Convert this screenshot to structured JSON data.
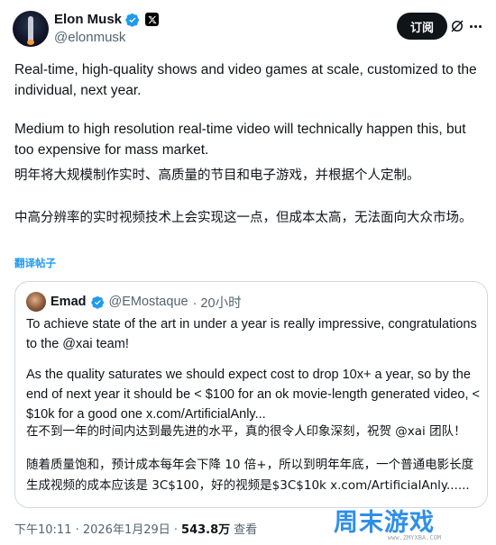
{
  "author": {
    "name": "Elon Musk",
    "handle": "@elonmusk",
    "subscribe_label": "订阅"
  },
  "post": {
    "p1": "Real-time, high-quality shows and video games at scale, customized to the individual, next year.",
    "p2": "Medium to high resolution real-time video will technically happen this, but too expensive for mass market.",
    "p3": "明年将大规模制作实时、高质量的节目和电子游戏，并根据个人定制。",
    "p4": "中高分辨率的实时视频技术上会实现这一点，但成本太高，无法面向大众市场。",
    "translate_label": "翻译帖子"
  },
  "quote": {
    "name": "Emad",
    "handle": "@EMostaque",
    "time": "· 20小时",
    "p1": "To achieve state of the art in under a year is really impressive, congratulations to the @xai team!",
    "p2": "As the quality saturates we should expect cost to drop 10x+ a year, so by the end of next year it should be < $100 for an ok movie-length generated video, < $10k for a good one x.com/ArtificialAnly...",
    "p3": "在不到一年的时间内达到最先进的水平，真的很令人印象深刻，祝贺 @xai 团队！",
    "p4": "随着质量饱和，预计成本每年会下降 10 倍+，所以到明年年底，一个普通电影长度生成视频的成本应该是 3C$100，好的视频是$3C$10k x.com/ArtificialAnly......"
  },
  "footer": {
    "timestamp": "下午10:11 · 2026年1月29日 ·",
    "views": "543.8万",
    "views_label": "查看"
  },
  "watermark": {
    "text": "周末游戏",
    "sub": "www.ZMYXBA.COM"
  },
  "colors": {
    "accent": "#1d9bf0",
    "text": "#0f1419",
    "muted": "#536471",
    "border": "#cfd9de"
  }
}
